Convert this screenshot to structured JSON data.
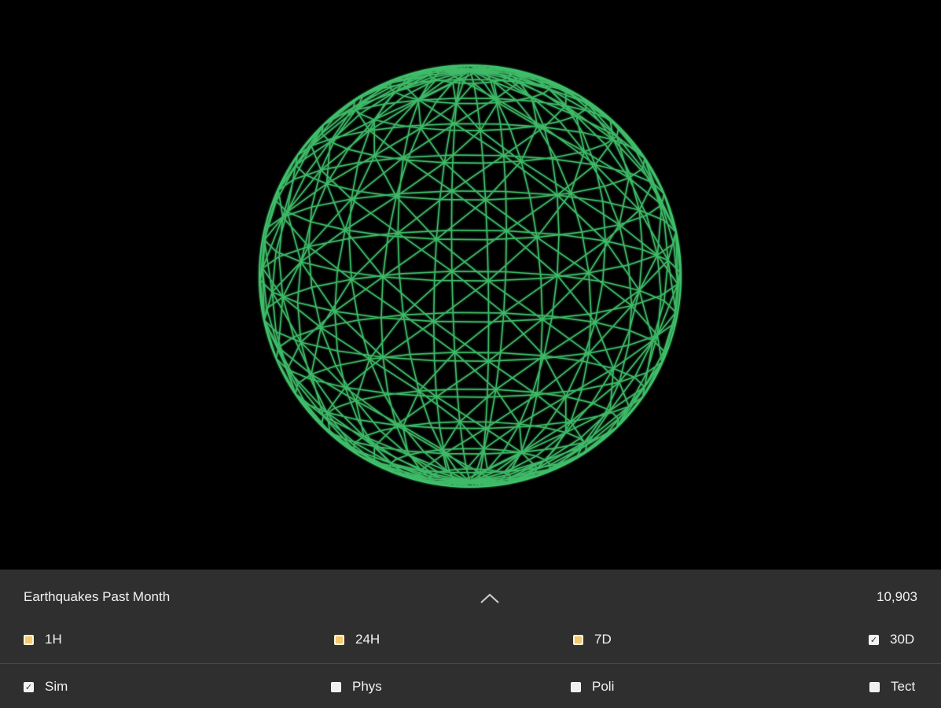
{
  "globe": {
    "wire_color": "#3fbf6a",
    "background": "#000000"
  },
  "panel": {
    "title": "Earthquakes Past Month",
    "count": "10,903",
    "toggle_icon": "chevron-up-icon",
    "background": "#2f2f2f",
    "time_filters": [
      {
        "label": "1H",
        "checked": false
      },
      {
        "label": "24H",
        "checked": false
      },
      {
        "label": "7D",
        "checked": false
      },
      {
        "label": "30D",
        "checked": true
      }
    ],
    "map_styles": [
      {
        "label": "Sim",
        "checked": true
      },
      {
        "label": "Phys",
        "checked": false
      },
      {
        "label": "Poli",
        "checked": false
      },
      {
        "label": "Tect",
        "checked": false
      }
    ]
  }
}
